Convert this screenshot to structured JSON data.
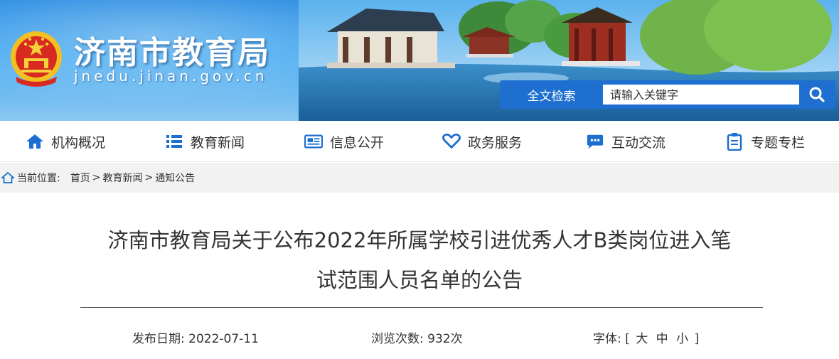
{
  "header": {
    "site_title": "济南市教育局",
    "site_domain": "jnedu.jinan.gov.cn",
    "emblem_icon": "national-emblem-icon",
    "search": {
      "label": "全文检索",
      "placeholder": "请输入关键字",
      "button_icon": "search-icon"
    }
  },
  "nav": {
    "items": [
      {
        "label": "机构概况",
        "icon": "home-icon"
      },
      {
        "label": "教育新闻",
        "icon": "list-icon"
      },
      {
        "label": "信息公开",
        "icon": "newspaper-icon"
      },
      {
        "label": "政务服务",
        "icon": "heart-icon"
      },
      {
        "label": "互动交流",
        "icon": "chat-icon"
      },
      {
        "label": "专题专栏",
        "icon": "clipboard-icon"
      }
    ]
  },
  "breadcrumb": {
    "prefix": "当前位置:",
    "items": [
      "首页",
      "教育新闻",
      "通知公告"
    ],
    "separator": ">"
  },
  "article": {
    "title_line1": "济南市教育局关于公布2022年所属学校引进优秀人才B类岗位进入笔",
    "title_line2": "试范围人员名单的公告",
    "publish_label": "发布日期:",
    "publish_date": "2022-07-11",
    "views_label": "浏览次数:",
    "views_value": "932次",
    "font_label": "字体:",
    "font_open": "[",
    "font_sizes": [
      "大",
      "中",
      "小"
    ],
    "font_close": "]"
  },
  "colors": {
    "brand_blue": "#1e6fd0",
    "nav_icon_blue": "#1c6fd1",
    "text": "#333333"
  }
}
